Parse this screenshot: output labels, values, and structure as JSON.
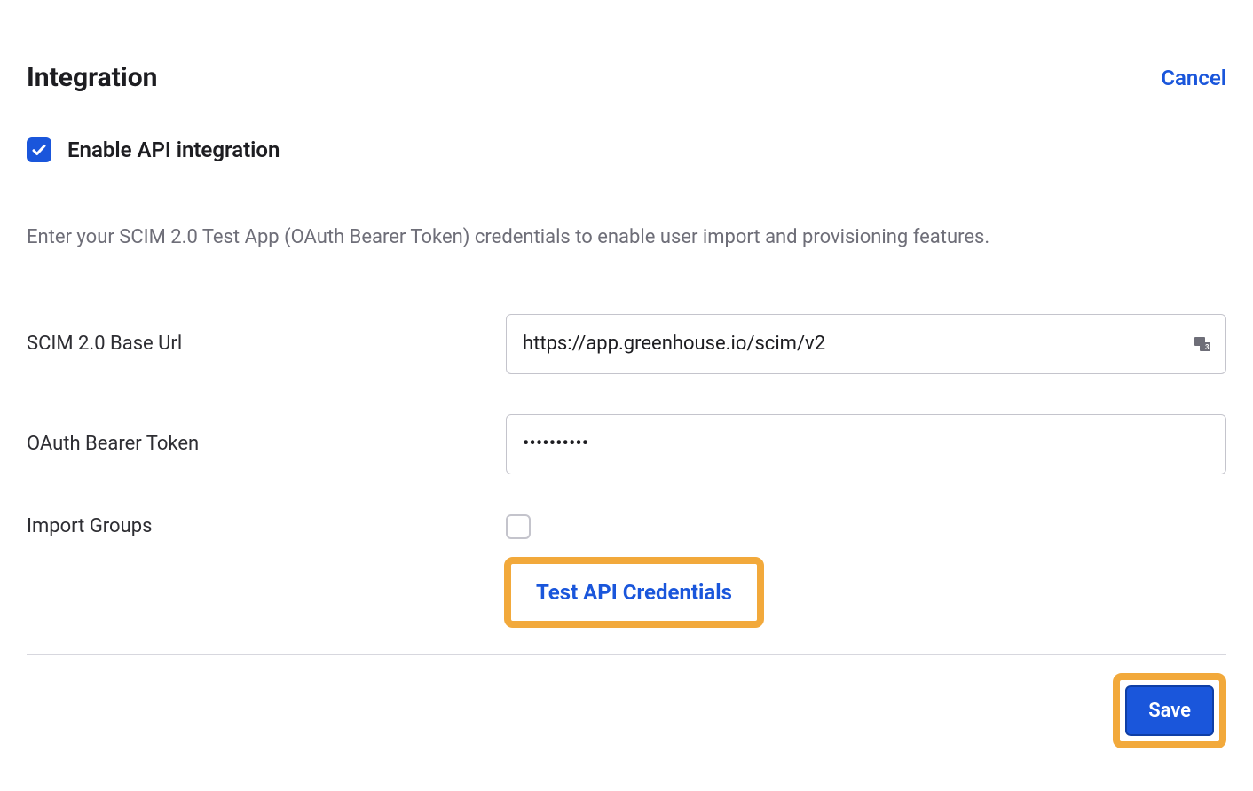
{
  "header": {
    "title": "Integration",
    "cancel_label": "Cancel"
  },
  "enable": {
    "label": "Enable API integration",
    "checked": true
  },
  "description": "Enter your SCIM 2.0 Test App (OAuth Bearer Token) credentials to enable user import and provisioning features.",
  "fields": {
    "base_url": {
      "label": "SCIM 2.0 Base Url",
      "value": "https://app.greenhouse.io/scim/v2"
    },
    "bearer_token": {
      "label": "OAuth Bearer Token",
      "value": "••••••••••"
    },
    "import_groups": {
      "label": "Import Groups",
      "checked": false
    }
  },
  "actions": {
    "test_label": "Test API Credentials",
    "save_label": "Save"
  }
}
